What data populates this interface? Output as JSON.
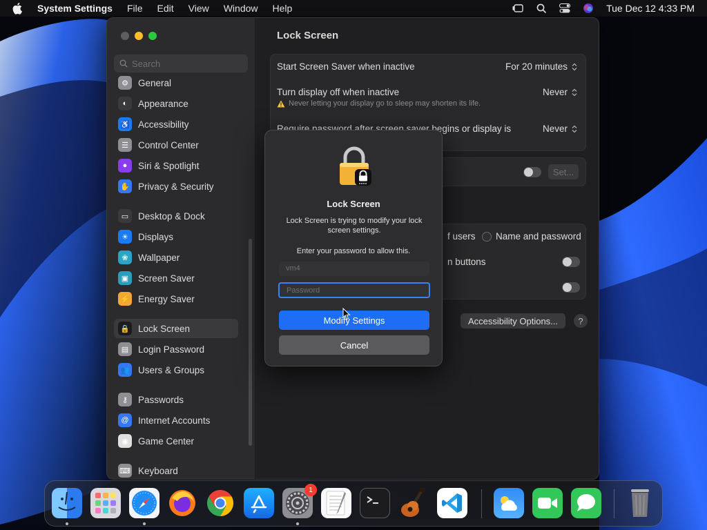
{
  "menubar": {
    "app_name": "System Settings",
    "menus": [
      "File",
      "Edit",
      "View",
      "Window",
      "Help"
    ],
    "clock": "Tue Dec 12  4:33 PM"
  },
  "sidebar": {
    "search_placeholder": "Search",
    "items": [
      {
        "label": "General",
        "icon": "gear-icon",
        "color": "#8e8e93"
      },
      {
        "label": "Appearance",
        "icon": "appearance-icon",
        "color": "#3a3a3c"
      },
      {
        "label": "Accessibility",
        "icon": "accessibility-icon",
        "color": "#1a7cf5"
      },
      {
        "label": "Control Center",
        "icon": "control-center-icon",
        "color": "#8e8e93"
      },
      {
        "label": "Siri & Spotlight",
        "icon": "siri-icon",
        "color": "#8a3cf0"
      },
      {
        "label": "Privacy & Security",
        "icon": "hand-icon",
        "color": "#3478f6"
      },
      {
        "label": "Desktop & Dock",
        "icon": "desktop-icon",
        "color": "#3a3a3c"
      },
      {
        "label": "Displays",
        "icon": "displays-icon",
        "color": "#1a7cf5"
      },
      {
        "label": "Wallpaper",
        "icon": "wallpaper-icon",
        "color": "#2aa5c9"
      },
      {
        "label": "Screen Saver",
        "icon": "screen-saver-icon",
        "color": "#2a9ebd"
      },
      {
        "label": "Energy Saver",
        "icon": "energy-icon",
        "color": "#f2a933"
      },
      {
        "label": "Lock Screen",
        "icon": "lock-icon",
        "color": "#1c1c1e"
      },
      {
        "label": "Login Password",
        "icon": "login-password-icon",
        "color": "#8e8e93"
      },
      {
        "label": "Users & Groups",
        "icon": "users-icon",
        "color": "#3478f6"
      },
      {
        "label": "Passwords",
        "icon": "key-icon",
        "color": "#8e8e93"
      },
      {
        "label": "Internet Accounts",
        "icon": "at-icon",
        "color": "#3478f6"
      },
      {
        "label": "Game Center",
        "icon": "game-center-icon",
        "color": "#e0e0e0"
      },
      {
        "label": "Keyboard",
        "icon": "keyboard-icon",
        "color": "#8e8e93"
      }
    ]
  },
  "content": {
    "title": "Lock Screen",
    "screen_saver_label": "Start Screen Saver when inactive",
    "screen_saver_value": "For 20 minutes",
    "display_off_label": "Turn display off when inactive",
    "display_off_value": "Never",
    "display_warning": "Never letting your display go to sleep may shorten its life.",
    "require_password_label": "Require password after screen saver begins or display is",
    "require_password_value": "Never",
    "set_button": "Set...",
    "users_partial": "f users",
    "name_password": "Name and password",
    "buttons_partial": "n buttons",
    "accessibility_options": "Accessibility Options...",
    "help": "?"
  },
  "dialog": {
    "title": "Lock Screen",
    "message": "Lock Screen is trying to modify your lock screen settings.",
    "prompt": "Enter your password to allow this.",
    "username": "vm4",
    "password_placeholder": "Password",
    "primary_button": "Modify Settings",
    "cancel_button": "Cancel"
  },
  "dock": {
    "settings_badge": "1",
    "apps": [
      "Finder",
      "Launchpad",
      "Safari",
      "Firefox",
      "Chrome",
      "App Store",
      "System Settings",
      "TextEdit",
      "Terminal",
      "GarageBand",
      "VS Code",
      "Weather",
      "FaceTime",
      "Messages",
      "Trash"
    ]
  }
}
